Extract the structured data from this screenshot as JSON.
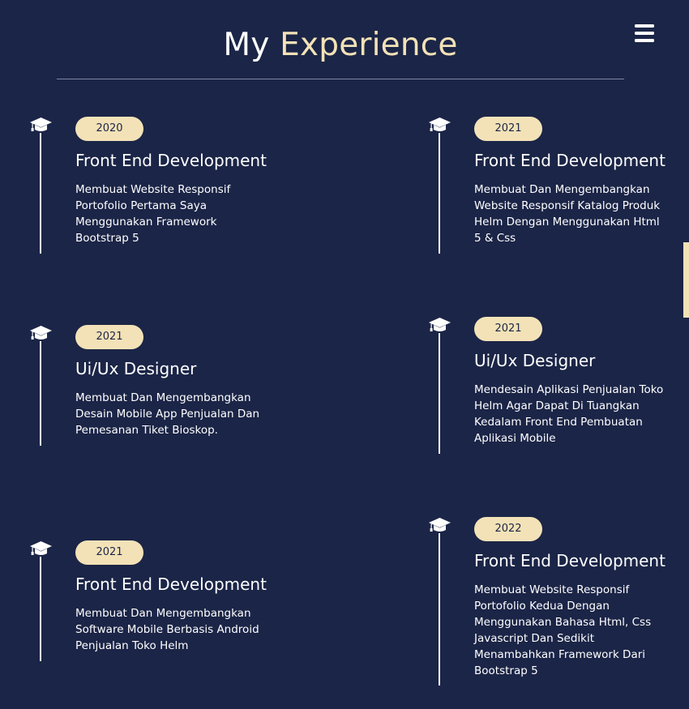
{
  "header": {
    "title_main": "My",
    "title_accent": "Experience",
    "menu_icon": "hamburger-menu-icon"
  },
  "colors": {
    "background": "#1b2547",
    "accent": "#f3e2b7",
    "text": "#ffffff"
  },
  "timeline_icon": "graduation-cap-icon",
  "experiences": [
    {
      "year": "2020",
      "role": "Front End Development",
      "description": "Membuat Website Responsif Portofolio Pertama Saya Menggunakan Framework Bootstrap 5"
    },
    {
      "year": "2021",
      "role": "Front End Development",
      "description": "Membuat Dan Mengembangkan Website Responsif Katalog Produk Helm Dengan Menggunakan Html 5 & Css"
    },
    {
      "year": "2021",
      "role": "Ui/Ux Designer",
      "description": "Membuat Dan Mengembangkan Desain Mobile App Penjualan Dan Pemesanan Tiket Bioskop."
    },
    {
      "year": "2021",
      "role": "Ui/Ux Designer",
      "description": "Mendesain Aplikasi Penjualan Toko Helm Agar Dapat Di Tuangkan Kedalam Front End Pembuatan Aplikasi Mobile"
    },
    {
      "year": "2021",
      "role": "Front End Development",
      "description": "Membuat Dan Mengembangkan Software Mobile Berbasis Android Penjualan Toko Helm"
    },
    {
      "year": "2022",
      "role": "Front End Development",
      "description": "Membuat Website Responsif Portofolio Kedua Dengan Menggunakan Bahasa Html, Css Javascript Dan Sedikit Menambahkan Framework Dari Bootstrap 5"
    }
  ]
}
